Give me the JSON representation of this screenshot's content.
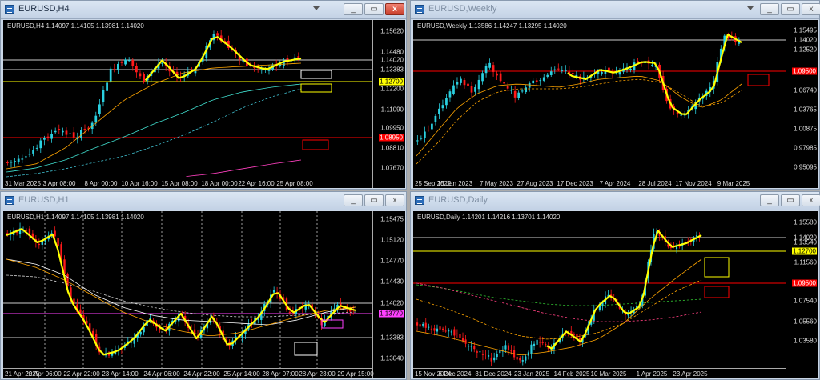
{
  "windows": [
    {
      "id": "h4",
      "title": "EURUSD,H4",
      "active": true,
      "symbol_line": "EURUSD,H4  1.14097 1.14105 1.13981 1.14020",
      "price_labels": [
        "1.15620",
        "1.14480",
        "1.14020",
        "1.13383",
        "1.12700",
        "1.12200",
        "1.11090",
        "1.09950",
        "1.08950",
        "1.08810",
        "1.07670"
      ],
      "time_labels": [
        "31 Mar 2025",
        "3 Apr 08:00",
        "8 Apr 00:00",
        "10 Apr 16:00",
        "15 Apr 08:00",
        "18 Apr 00:00",
        "22 Apr 16:00",
        "25 Apr 08:00"
      ]
    },
    {
      "id": "weekly",
      "title": "EURUSD,Weekly",
      "active": false,
      "symbol_line": "EURUSD,Weekly  1.13586 1.14247 1.13295 1.14020",
      "price_labels": [
        "1.15495",
        "1.14020",
        "1.12520",
        "1.09500",
        "1.06740",
        "1.03765",
        "1.00875",
        "0.97985",
        "0.95095"
      ],
      "time_labels": [
        "25 Sep 2022",
        "15 Jan 2023",
        "7 May 2023",
        "27 Aug 2023",
        "17 Dec 2023",
        "7 Apr 2024",
        "28 Jul 2024",
        "17 Nov 2024",
        "9 Mar 2025"
      ]
    },
    {
      "id": "h1",
      "title": "EURUSD,H1",
      "active": false,
      "symbol_line": "EURUSD,H1  1.14097 1.14105 1.13981 1.14020",
      "price_labels": [
        "1.15475",
        "1.15120",
        "1.14770",
        "1.14430",
        "1.14020",
        "1.13770",
        "1.13383",
        "1.13040"
      ],
      "time_labels": [
        "21 Apr 2025",
        "22 Apr 06:00",
        "22 Apr 22:00",
        "23 Apr 14:00",
        "24 Apr 06:00",
        "24 Apr 22:00",
        "25 Apr 14:00",
        "28 Apr 07:00",
        "28 Apr 23:00",
        "29 Apr 15:00"
      ]
    },
    {
      "id": "daily",
      "title": "EURUSD,Daily",
      "active": false,
      "symbol_line": "EURUSD,Daily  1.14201 1.14216 1.13701 1.14020",
      "price_labels": [
        "1.15580",
        "1.14020",
        "1.13540",
        "1.12700",
        "1.11560",
        "1.09500",
        "1.07540",
        "1.05560",
        "1.03580"
      ],
      "time_labels": [
        "15 Nov 2024",
        "6 Dec 2024",
        "31 Dec 2024",
        "23 Jan 2025",
        "14 Feb 2025",
        "10 Mar 2025",
        "1 Apr 2025",
        "23 Apr 2025"
      ]
    }
  ],
  "buttons": {
    "minimize": "_",
    "restore": "▭",
    "close": "x"
  },
  "colors": {
    "bull": "#2ad0e0",
    "bear": "#ff1a1a",
    "zigzag": "#ffff00",
    "support": "#ffff00",
    "resistance": "#ff0000",
    "ma": "#ffa500"
  }
}
